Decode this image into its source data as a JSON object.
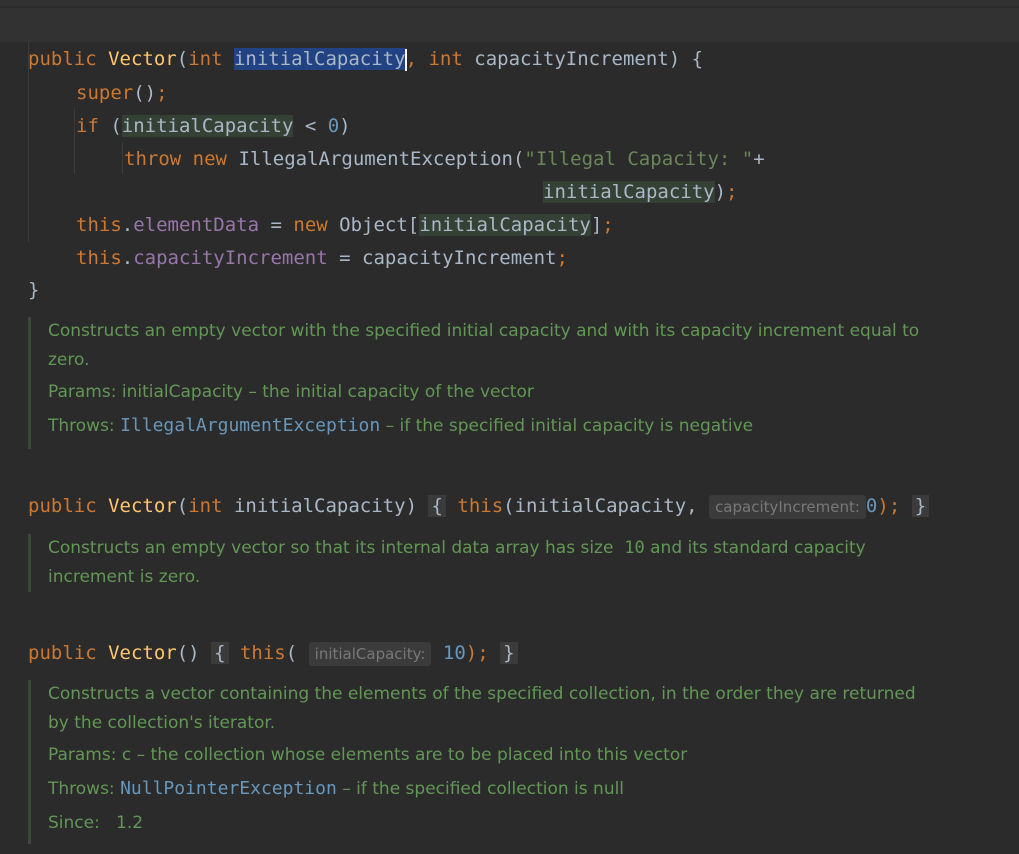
{
  "code": {
    "l1": {
      "kw_public": "public",
      "name": "Vector",
      "paren_open": "(",
      "kw_int": "int",
      "param1": "initialCapacity",
      "comma": ",",
      "kw_int2": "int",
      "param2": "capacityIncrement",
      "close": ") {"
    },
    "l2": {
      "kw_super": "super",
      "rest": "()",
      "semi": ";"
    },
    "l3": {
      "kw_if": "if",
      "open": "(",
      "var": "initialCapacity",
      "op": " < ",
      "num": "0",
      "close": ")"
    },
    "l4": {
      "kw_throw": "throw",
      "kw_new": "new",
      "cls": "IllegalArgumentException(",
      "str": "\"Illegal Capacity: \"",
      "plus": "+"
    },
    "l5": {
      "var": "initialCapacity",
      "close": ")",
      "semi": ";"
    },
    "l6": {
      "kw_this": "this",
      "dot": ".",
      "field": "elementData",
      "eq": " = ",
      "kw_new": "new",
      "cls": "Object[",
      "var": "initialCapacity",
      "close": "]",
      "semi": ";"
    },
    "l7": {
      "kw_this": "this",
      "dot": ".",
      "field": "capacityIncrement",
      "eq": " = ",
      "var": "capacityIncrement",
      "semi": ";"
    },
    "l8": {
      "brace": "}"
    }
  },
  "doc1": {
    "line1": "Constructs an empty vector with the specified initial capacity and with its capacity increment equal to",
    "line2": "zero.",
    "params_label": "Params:",
    "params_text": "initialCapacity – the initial capacity of the vector",
    "throws_label": "Throws:",
    "throws_link": "IllegalArgumentException",
    "throws_text": " – if the specified initial capacity is negative"
  },
  "ctor2": {
    "kw_public": "public",
    "name": "Vector",
    "open": "(",
    "kw_int": "int",
    "param": "initialCapacity",
    "close": ")",
    "fold_open": "{",
    "kw_this": "this",
    "args": "(initialCapacity,",
    "hint": "capacityIncrement:",
    "num": "0",
    "end": ");",
    "fold_close": "}"
  },
  "doc2": {
    "line1_a": "Constructs an empty vector so that its internal data array has size ",
    "line1_code": "10",
    "line1_b": " and its standard capacity",
    "line2": "increment is zero."
  },
  "ctor3": {
    "kw_public": "public",
    "name": "Vector",
    "parens": "()",
    "fold_open": "{",
    "kw_this": "this",
    "open": "(",
    "hint": "initialCapacity:",
    "num": "10",
    "end": ");",
    "fold_close": "}"
  },
  "doc3": {
    "line1": "Constructs a vector containing the elements of the specified collection, in the order they are returned",
    "line2": "by the collection's iterator.",
    "params_label": "Params:",
    "params_text": "c – the collection whose elements are to be placed into this vector",
    "throws_label": "Throws:",
    "throws_link": "NullPointerException",
    "throws_text": " – if the specified collection is null",
    "since_label": "Since:",
    "since_value": "1.2"
  }
}
